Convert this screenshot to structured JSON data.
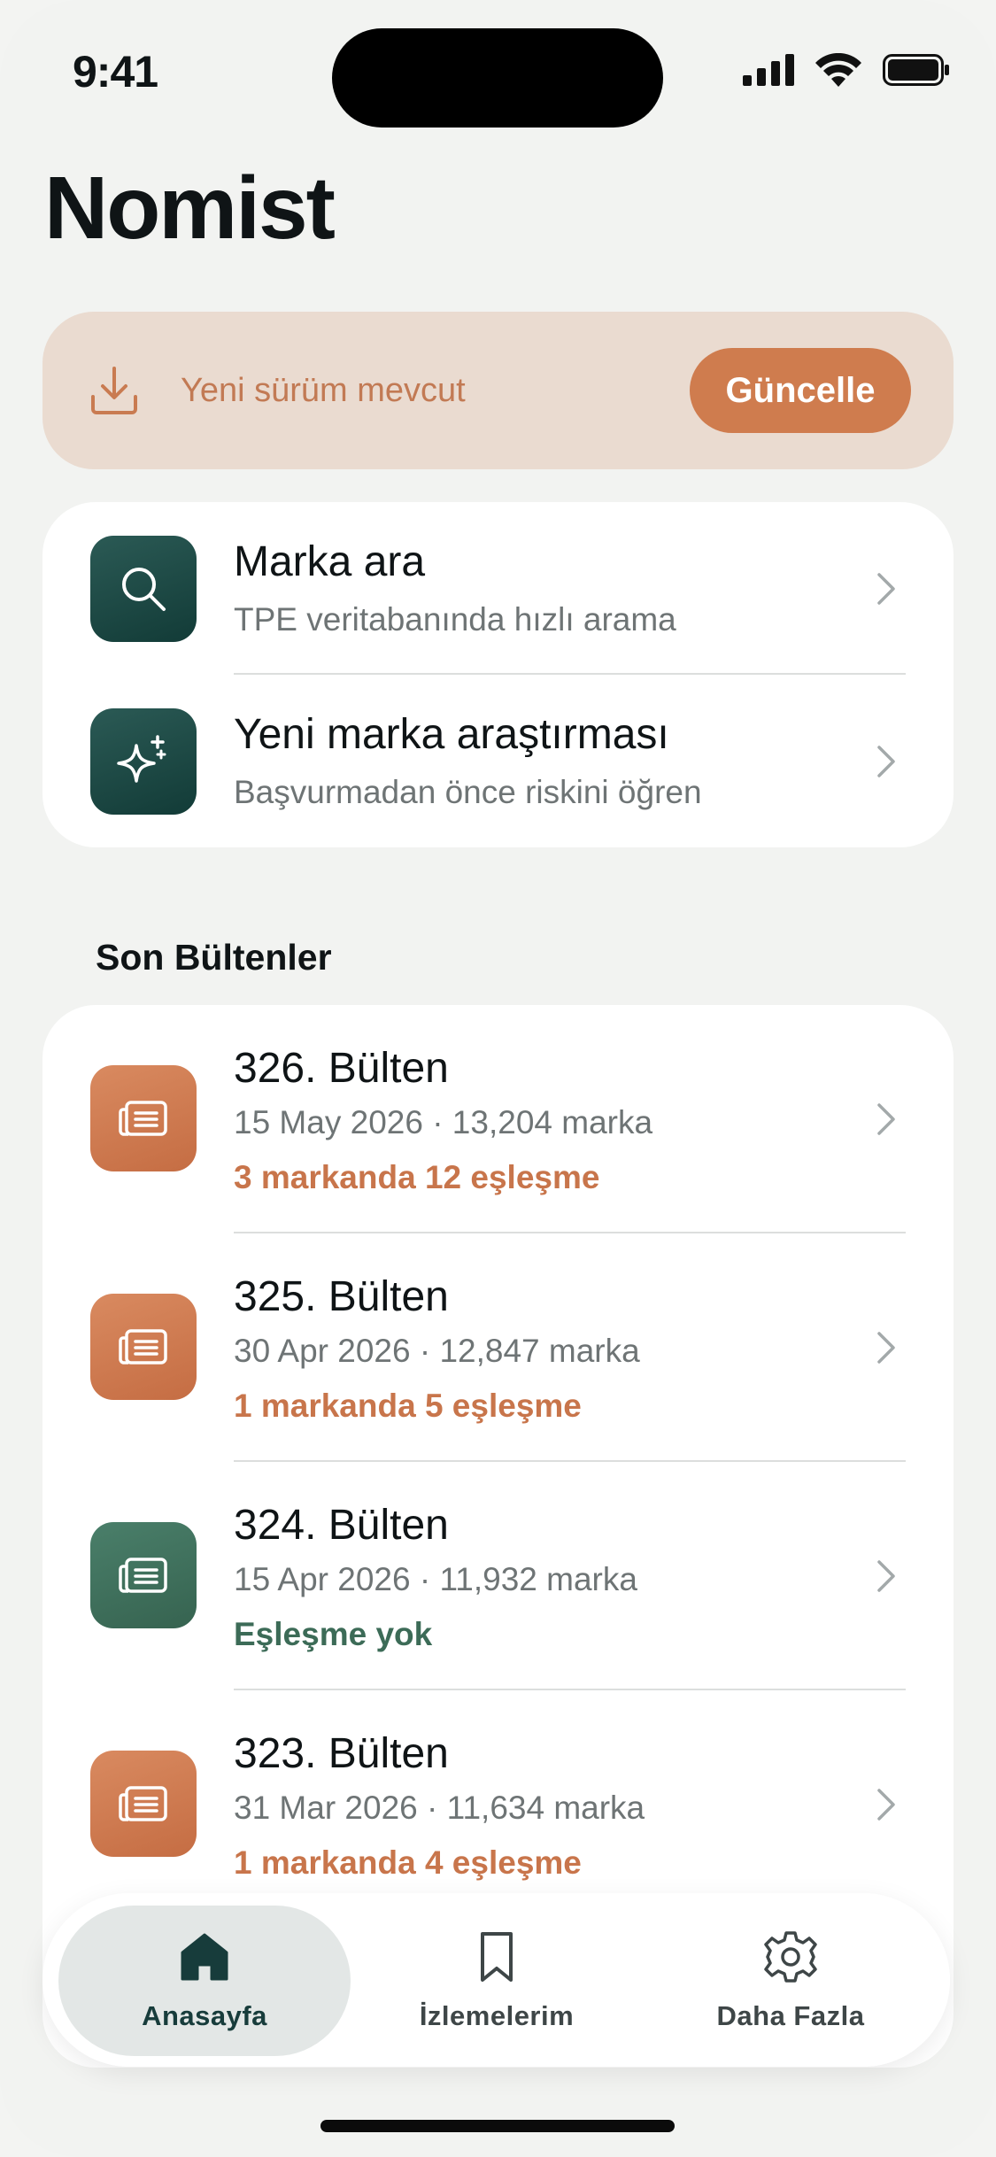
{
  "status": {
    "time": "9:41"
  },
  "page": {
    "title": "Nomist"
  },
  "banner": {
    "text": "Yeni sürüm mevcut",
    "button": "Güncelle"
  },
  "actions": [
    {
      "title": "Marka ara",
      "subtitle": "TPE veritabanında hızlı arama",
      "icon": "search-icon"
    },
    {
      "title": "Yeni marka araştırması",
      "subtitle": "Başvurmadan önce riskini öğren",
      "icon": "sparkle-icon"
    }
  ],
  "section": {
    "title": "Son Bültenler"
  },
  "bulletins": [
    {
      "title": "326. Bülten",
      "meta": "15 May 2026 · 13,204 marka",
      "status": "3 markanda 12 eşleşme",
      "tone": "orange"
    },
    {
      "title": "325. Bülten",
      "meta": "30 Apr 2026 · 12,847 marka",
      "status": "1 markanda 5 eşleşme",
      "tone": "orange"
    },
    {
      "title": "324. Bülten",
      "meta": "15 Apr 2026 · 11,932 marka",
      "status": "Eşleşme yok",
      "tone": "green"
    },
    {
      "title": "323. Bülten",
      "meta": "31 Mar 2026 · 11,634 marka",
      "status": "1 markanda 4 eşleşme",
      "tone": "orange"
    }
  ],
  "tabs": [
    {
      "label": "Anasayfa",
      "icon": "home-icon",
      "active": true
    },
    {
      "label": "İzlemelerim",
      "icon": "bookmark-icon",
      "active": false
    },
    {
      "label": "Daha Fazla",
      "icon": "gear-icon",
      "active": false
    }
  ],
  "colors": {
    "accent": "#cf7c4e",
    "brand_dark": "#123b37",
    "success": "#3c6b57"
  }
}
